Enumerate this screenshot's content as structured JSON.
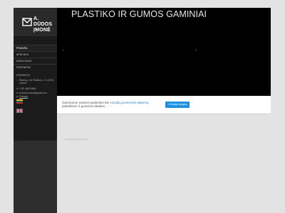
{
  "logo": {
    "line1": "A. DŪDOS",
    "line2": "ĮMONĖ"
  },
  "nav": {
    "items": [
      {
        "label": "PRADŽIA",
        "active": true
      },
      {
        "label": "APIE MUS",
        "active": false
      },
      {
        "label": "KATALOGAS",
        "active": false
      },
      {
        "label": "KONTAKTAI",
        "active": false
      }
    ]
  },
  "contacts": {
    "title": "KONTAKTAI",
    "address_line1": "Šiaulių g. 66, Rokiškio r. LT-42100,",
    "address_line2": "Lietuva",
    "phone": "+370 458 53666",
    "email": "a.dudos.imone@gmail.com",
    "website": "Puslapis"
  },
  "flags": [
    "lt-flag",
    "uk-flag"
  ],
  "slider": {
    "title": "PLASTIKO IR GUMOS GAMINIAI"
  },
  "info": {
    "text_before": "Gaminame įvairios paskirties bei ",
    "link": "vizualių pramonės taikymų",
    "text_after": " plastikines ir gumines detales."
  },
  "cta": {
    "label": "Skaityti daugiau"
  },
  "footer": {
    "copyright": "© A. Dūdos įmonė, 2015"
  },
  "colors": {
    "accent": "#1c8fe0",
    "sidebar": "#1b1b1b"
  }
}
